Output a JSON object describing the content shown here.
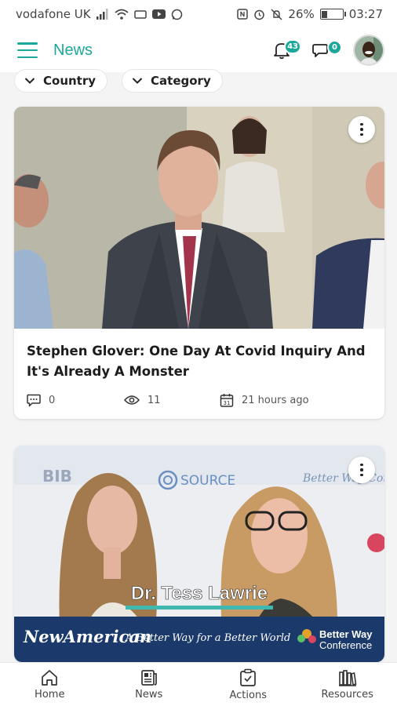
{
  "status_bar": {
    "carrier": "vodafone UK",
    "battery": "26%",
    "battery_level": 0.26,
    "time": "03:27"
  },
  "header": {
    "title": "News",
    "notification_count": "43",
    "message_count": "0"
  },
  "filters": [
    {
      "label": "Country"
    },
    {
      "label": "Category"
    }
  ],
  "articles": [
    {
      "title": "Stephen Glover: One Day At Covid Inquiry And It's Already A Monster",
      "comments": "0",
      "views": "11",
      "posted": "21 hours ago"
    },
    {
      "image_caption": "Dr. Tess Lawrie",
      "banner_left": "NewAmerican",
      "banner_middle": "A Better Way for a Better World",
      "banner_right_line1": "Better Way",
      "banner_right_line2": "Conference",
      "backdrop_source": "SOURCE",
      "backdrop_conference": "Better Way Conference"
    }
  ],
  "bottom_nav": [
    {
      "label": "Home",
      "icon": "home-icon"
    },
    {
      "label": "News",
      "icon": "news-icon"
    },
    {
      "label": "Actions",
      "icon": "actions-icon"
    },
    {
      "label": "Resources",
      "icon": "resources-icon"
    }
  ],
  "colors": {
    "accent": "#1ba89a",
    "banner": "#1b3a6b"
  }
}
